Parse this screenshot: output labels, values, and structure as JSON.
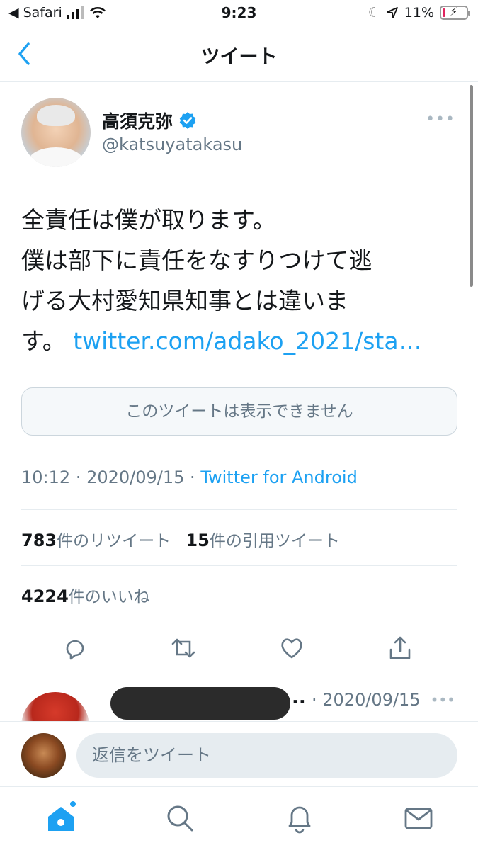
{
  "status_bar": {
    "back_app": "Safari",
    "time": "9:23",
    "battery": "11%",
    "battery_level": 0.11,
    "battery_color": "#e0245e"
  },
  "nav": {
    "title": "ツイート",
    "back_icon": "chevron-left-icon"
  },
  "tweet": {
    "author_name": "高須克弥",
    "author_handle": "@katsuyatakasu",
    "body_lines": [
      "全責任は僕が取ります。",
      "僕は部下に責任をなすりつけて逃",
      "げる大村愛知県知事とは違いま",
      "す。"
    ],
    "link_text": "twitter.com/adako_2021/sta…",
    "unavailable_text": "このツイートは表示できません",
    "time": "10:12",
    "date": "2020/09/15",
    "source": "Twitter for Android",
    "retweets_count": "783",
    "retweets_label": "件のリツイート",
    "quotes_count": "15",
    "quotes_label": "件の引用ツイート",
    "likes_count": "4224",
    "likes_label": "件のいいね"
  },
  "actions": [
    "reply-icon",
    "retweet-icon",
    "like-icon",
    "share-icon"
  ],
  "reply_preview": {
    "ellipsis": "..",
    "date": "· 2020/09/15"
  },
  "composer": {
    "placeholder": "返信をツイート"
  },
  "tab_bar": [
    "home-icon",
    "search-icon",
    "notifications-icon",
    "messages-icon"
  ],
  "colors": {
    "accent": "#1da1f2",
    "secondary_text": "#657786"
  }
}
